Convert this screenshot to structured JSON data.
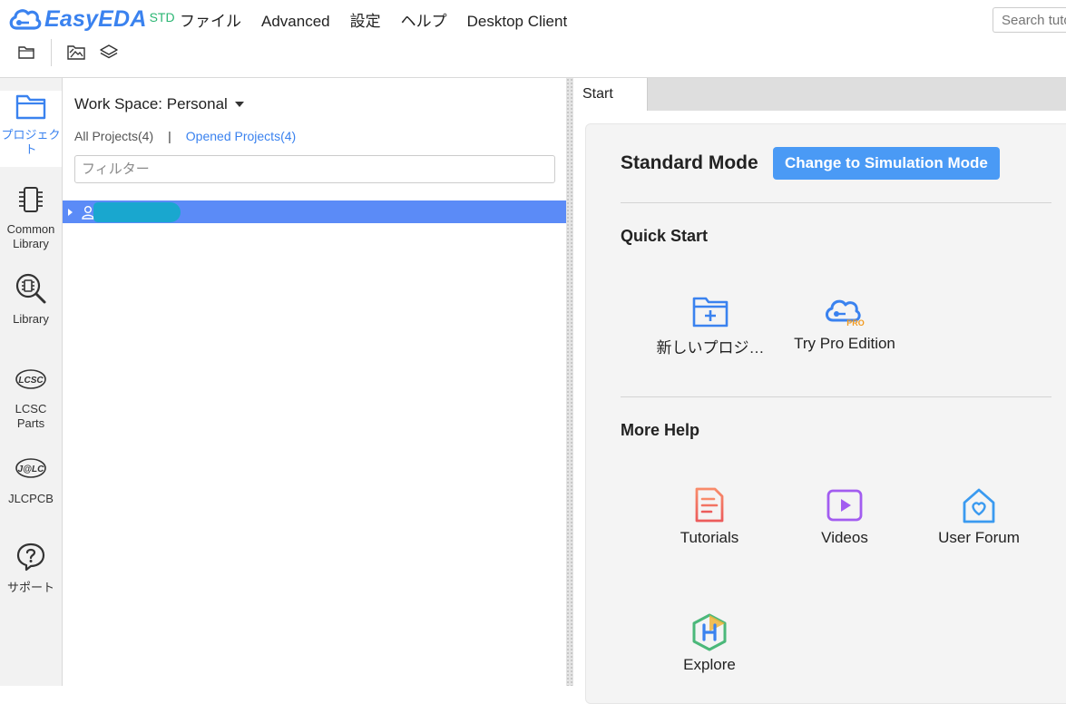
{
  "app": {
    "logo_text": "EasyEDA",
    "logo_edition": "STD",
    "menu": [
      "ファイル",
      "Advanced",
      "設定",
      "ヘルプ",
      "Desktop Client"
    ],
    "search_placeholder": "Search tuto",
    "toolbar": [
      "folder-icon",
      "image-folder-icon",
      "layers-icon"
    ]
  },
  "rail": {
    "items": [
      {
        "label": "プロジェクト",
        "icon": "folder-icon",
        "active": true
      },
      {
        "label": "Common Library",
        "icon": "chip-icon"
      },
      {
        "label": "Library",
        "icon": "search-chip-icon"
      },
      {
        "label": "LCSC Parts",
        "icon": "lcsc-logo-icon",
        "logo": "LCSC"
      },
      {
        "label": "JLCPCB",
        "icon": "jlc-logo-icon",
        "logo": "J@LC"
      },
      {
        "label": "サポート",
        "icon": "help-icon"
      }
    ]
  },
  "panel": {
    "workspace": "Work Space: Personal",
    "all_projects": "All Projects(4)",
    "separator": "|",
    "opened_projects": "Opened Projects(4)",
    "filter_placeholder": "フィルター"
  },
  "tabs": [
    "Start"
  ],
  "start": {
    "mode_title": "Standard Mode",
    "mode_button": "Change to Simulation Mode",
    "quick_start_title": "Quick Start",
    "quick_start": [
      {
        "label": "新しいプロジ…",
        "icon": "new-project-icon"
      },
      {
        "label": "Try Pro Edition",
        "icon": "pro-cloud-icon",
        "badge": "PRO"
      }
    ],
    "more_help_title": "More Help",
    "more_help": [
      {
        "label": "Tutorials",
        "icon": "tutorials-icon"
      },
      {
        "label": "Videos",
        "icon": "videos-icon"
      },
      {
        "label": "User Forum",
        "icon": "forum-icon"
      },
      {
        "label": "Explore",
        "icon": "explore-icon"
      }
    ]
  },
  "colors": {
    "accent": "#3a82ef",
    "selected_row": "#5b8bf7",
    "mode_button": "#4a9af5",
    "std_green": "#2bb673"
  }
}
